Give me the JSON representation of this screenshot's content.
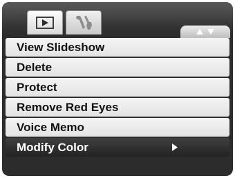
{
  "tabs": [
    {
      "icon": "play-icon",
      "active": true
    },
    {
      "icon": "wrench-screwdriver-icon",
      "active": false
    }
  ],
  "page_indicator": {
    "up_icon": "triangle-up-icon",
    "down_icon": "triangle-down-icon"
  },
  "menu": {
    "items": [
      {
        "label": "View Slideshow"
      },
      {
        "label": "Delete"
      },
      {
        "label": "Protect"
      },
      {
        "label": "Remove Red Eyes"
      },
      {
        "label": "Voice Memo"
      },
      {
        "label": "Modify Color",
        "selected": true,
        "submenu_icon": "triangle-right-icon"
      }
    ]
  },
  "colors": {
    "background": "#2c2c2c",
    "item": "#ececec",
    "selected_item": "#2f2f2f",
    "text": "#111111",
    "selected_text": "#ffffff"
  }
}
